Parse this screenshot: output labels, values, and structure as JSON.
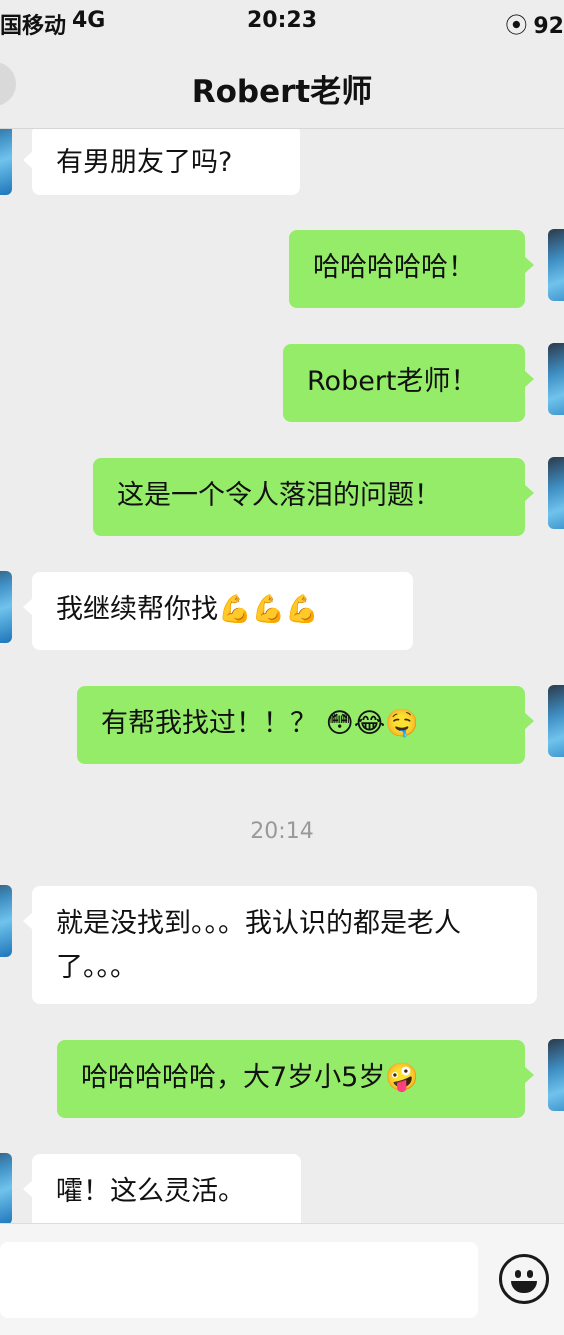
{
  "status": {
    "carrier": "国移动",
    "network": "4G",
    "time": "20:23",
    "battery": "92"
  },
  "header": {
    "title": "Robert老师"
  },
  "messages": [
    {
      "text": "有男朋友了吗?"
    },
    {
      "text": "哈哈哈哈哈！"
    },
    {
      "text": "Robert老师！"
    },
    {
      "text": "这是一个令人落泪的问题！"
    },
    {
      "text": "我继续帮你找💪💪💪"
    },
    {
      "text": "有帮我找过！！？ 😳😂🤤"
    },
    {
      "text": "就是没找到。。。我认识的都是老人了。。。"
    },
    {
      "text": "哈哈哈哈哈，大7岁小5岁🤪"
    },
    {
      "text": "嚯！这么灵活。"
    }
  ],
  "divider_time": "20:14",
  "colors": {
    "outgoing": "#95ec69",
    "incoming": "#ffffff",
    "background": "#ededed"
  },
  "icons": {
    "emoji_button": "smiley-face-icon",
    "lock": "rotation-lock-icon"
  }
}
